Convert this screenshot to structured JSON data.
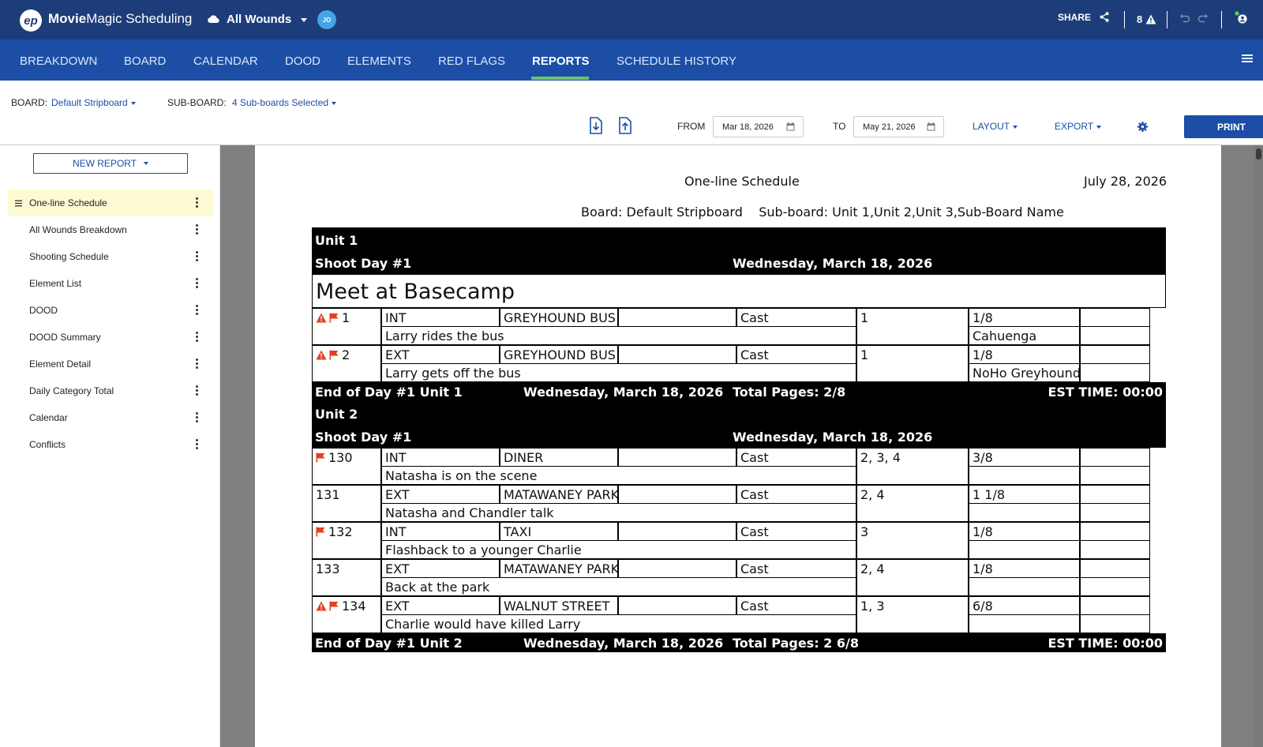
{
  "header": {
    "logo_text": "ep",
    "app_name_bold": "Movie",
    "app_name_rest": "Magic Scheduling",
    "project": "All Wounds",
    "avatar_initials": "JO",
    "share_label": "SHARE",
    "alert_count": "8"
  },
  "nav": {
    "items": [
      "BREAKDOWN",
      "BOARD",
      "CALENDAR",
      "DOOD",
      "ELEMENTS",
      "RED FLAGS",
      "REPORTS",
      "SCHEDULE HISTORY"
    ],
    "active": "REPORTS"
  },
  "toolbar": {
    "board_label": "BOARD:",
    "board_value": "Default Stripboard",
    "subboard_label": "SUB-BOARD:",
    "subboard_value": "4 Sub-boards Selected",
    "from_label": "FROM",
    "from_value": "Mar 18, 2026",
    "to_label": "TO",
    "to_value": "May 21, 2026",
    "layout_label": "LAYOUT",
    "export_label": "EXPORT",
    "print_label": "PRINT"
  },
  "sidebar": {
    "new_report_label": "NEW REPORT",
    "items": [
      {
        "label": "One-line Schedule",
        "selected": true
      },
      {
        "label": "All Wounds Breakdown"
      },
      {
        "label": "Shooting Schedule"
      },
      {
        "label": "Element List"
      },
      {
        "label": "DOOD"
      },
      {
        "label": "DOOD Summary"
      },
      {
        "label": "Element Detail"
      },
      {
        "label": "Daily Category Total"
      },
      {
        "label": "Calendar"
      },
      {
        "label": "Conflicts"
      }
    ]
  },
  "report": {
    "title": "One-line Schedule",
    "date": "July 28, 2026",
    "board_line": "Board: Default Stripboard    Sub-board: Unit 1,Unit 2,Unit 3,Sub-Board Name",
    "units": [
      {
        "name": "Unit 1",
        "shoot_day": "Shoot Day #1",
        "day_date": "Wednesday, March 18, 2026",
        "banner": "Meet at Basecamp",
        "scenes": [
          {
            "num": "1",
            "warn": true,
            "flag": true,
            "ie": "INT",
            "set": "GREYHOUND BUS",
            "cat": "Cast",
            "cast": "1",
            "pages": "1/8",
            "desc": "Larry rides the bus",
            "location": "Cahuenga"
          },
          {
            "num": "2",
            "warn": true,
            "flag": true,
            "ie": "EXT",
            "set": "GREYHOUND BUS",
            "cat": "Cast",
            "cast": "1",
            "pages": "1/8",
            "desc": "Larry gets off the bus",
            "location": "NoHo Greyhound"
          }
        ],
        "end_label": "End of Day #1 Unit 1",
        "end_date": "Wednesday, March 18, 2026",
        "total_pages": "Total Pages: 2/8",
        "est_time": "EST TIME: 00:00"
      },
      {
        "name": "Unit 2",
        "shoot_day": "Shoot Day #1",
        "day_date": "Wednesday, March 18, 2026",
        "banner": "",
        "scenes": [
          {
            "num": "130",
            "warn": false,
            "flag": true,
            "ie": "INT",
            "set": "DINER",
            "cat": "Cast",
            "cast": "2, 3, 4",
            "pages": "3/8",
            "desc": "Natasha is on the scene",
            "location": ""
          },
          {
            "num": "131",
            "warn": false,
            "flag": false,
            "ie": "EXT",
            "set": "MATAWANEY PARK",
            "cat": "Cast",
            "cast": "2, 4",
            "pages": "1 1/8",
            "desc": "Natasha and Chandler talk",
            "location": ""
          },
          {
            "num": "132",
            "warn": false,
            "flag": true,
            "ie": "INT",
            "set": "TAXI",
            "cat": "Cast",
            "cast": "3",
            "pages": "1/8",
            "desc": "Flashback to a younger Charlie",
            "location": ""
          },
          {
            "num": "133",
            "warn": false,
            "flag": false,
            "ie": "EXT",
            "set": "MATAWANEY PARK",
            "cat": "Cast",
            "cast": "2, 4",
            "pages": "1/8",
            "desc": "Back at the park",
            "location": ""
          },
          {
            "num": "134",
            "warn": true,
            "flag": true,
            "ie": "EXT",
            "set": "WALNUT STREET",
            "cat": "Cast",
            "cast": "1, 3",
            "pages": "6/8",
            "desc": "Charlie would have killed Larry",
            "location": ""
          }
        ],
        "end_label": "End of Day #1 Unit 2",
        "end_date": "Wednesday, March 18, 2026",
        "total_pages": "Total Pages: 2 6/8",
        "est_time": "EST TIME: 00:00"
      }
    ]
  },
  "colors": {
    "topbar": "#1d3d7a",
    "navbar": "#1c4ea6",
    "accent": "#1c4ea6",
    "active_tab_underline": "#70c26a",
    "flag": "#e3401f",
    "selected_row": "#fcfbd3"
  }
}
